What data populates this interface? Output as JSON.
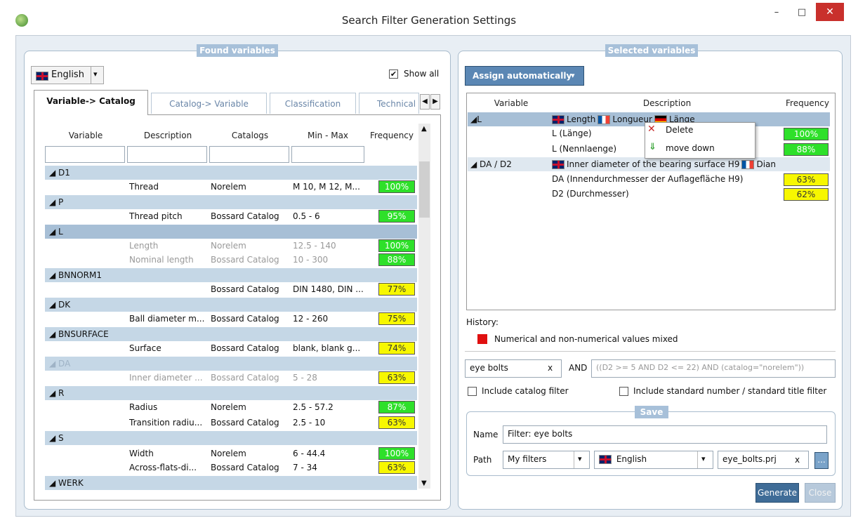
{
  "window": {
    "title": "Search Filter Generation Settings",
    "minimize": "–",
    "maximize": "□",
    "close": "✕"
  },
  "colors": {
    "legend": "#a7c0d9",
    "green": "#2ee02a",
    "yellow": "#f7f700",
    "accent": "#3f6c97"
  },
  "left": {
    "legend": "Found variables",
    "language": "English",
    "show_all": "Show all",
    "tabs": [
      "Variable-> Catalog",
      "Catalog-> Variable",
      "Classification",
      "Technical"
    ],
    "columns": [
      "Variable",
      "Description",
      "Catalogs",
      "Min - Max",
      "Frequency"
    ],
    "rows": {
      "g1": "D1",
      "r1": {
        "desc": "Thread",
        "cat": "Norelem",
        "minmax": "M 10, M 12, M...",
        "freq": "100%"
      },
      "g2": "P",
      "r2": {
        "desc": "Thread pitch",
        "cat": "Bossard Catalog",
        "minmax": "0.5 - 6",
        "freq": "95%"
      },
      "g3": "L",
      "r3a": {
        "desc": "Length",
        "cat": "Norelem",
        "minmax": "12.5 - 140",
        "freq": "100%"
      },
      "r3b": {
        "desc": "Nominal length",
        "cat": "Bossard Catalog",
        "minmax": "10 - 300",
        "freq": "88%"
      },
      "g4": "BNNORM1",
      "r4": {
        "desc": "",
        "cat": "Bossard Catalog",
        "minmax": "DIN 1480, DIN ...",
        "freq": "77%"
      },
      "g5": "DK",
      "r5": {
        "desc": "Ball diameter m...",
        "cat": "Bossard Catalog",
        "minmax": "12 - 260",
        "freq": "75%"
      },
      "g6": "BNSURFACE",
      "r6": {
        "desc": "Surface",
        "cat": "Bossard Catalog",
        "minmax": "blank, blank g...",
        "freq": "74%"
      },
      "g7": "DA",
      "r7": {
        "desc": "Inner diameter ...",
        "cat": "Bossard Catalog",
        "minmax": "5 - 28",
        "freq": "63%"
      },
      "g8": "R",
      "r8a": {
        "desc": "Radius",
        "cat": "Norelem",
        "minmax": "2.5 - 57.2",
        "freq": "87%"
      },
      "r8b": {
        "desc": "Transition radiu...",
        "cat": "Bossard Catalog",
        "minmax": "2.5 - 10",
        "freq": "63%"
      },
      "g9": "S",
      "r9a": {
        "desc": "Width",
        "cat": "Norelem",
        "minmax": "6 - 44.4",
        "freq": "100%"
      },
      "r9b": {
        "desc": "Across-flats-di...",
        "cat": "Bossard Catalog",
        "minmax": "7 - 34",
        "freq": "63%"
      },
      "g10": "WERK"
    }
  },
  "right": {
    "legend": "Selected variables",
    "assign": "Assign automatically",
    "columns": [
      "Variable",
      "Description",
      "Frequency"
    ],
    "tree": {
      "l_var": "L",
      "l_desc_en": "Length",
      "l_desc_fr": "Longueur",
      "l_desc_de": "Länge",
      "l1": {
        "name": "L (Länge)",
        "freq": "100%"
      },
      "l2": {
        "name": "L (Nennlaenge)",
        "freq": "88%"
      },
      "da_var": "DA / D2",
      "da_desc_en": "Inner diameter of the bearing surface H9",
      "da_desc_fr": "Dian",
      "da1": {
        "name": "DA (Innendurchmesser der Auflagefläche H9)",
        "freq": "63%"
      },
      "da2": {
        "name": "D2 (Durchmesser)",
        "freq": "62%"
      }
    },
    "context_menu": {
      "delete": "Delete",
      "move_down": "move down"
    },
    "history_label": "History:",
    "history_item": "Numerical and non-numerical values mixed",
    "search_value": "eye bolts",
    "clear": "x",
    "and": "AND",
    "expression": "((D2 >= 5 AND D2 <= 22) AND (catalog=\"norelem\"))",
    "include_catalog": "Include catalog filter",
    "include_standard": "Include standard number / standard title filter",
    "save_legend": "Save",
    "name_label": "Name",
    "name_value": "Filter: eye bolts",
    "path_label": "Path",
    "path_value": "My filters",
    "path_language": "English",
    "file_value": "eye_bolts.prj",
    "browse": "...",
    "generate": "Generate",
    "close": "Close"
  }
}
